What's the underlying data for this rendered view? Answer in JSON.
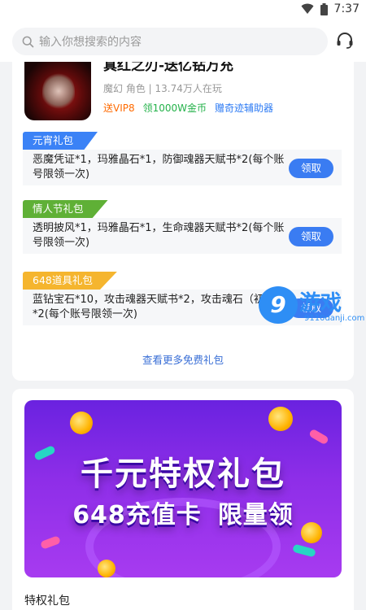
{
  "status_bar": {
    "time": "7:37",
    "icons": [
      "wifi-icon",
      "battery-icon"
    ]
  },
  "search": {
    "placeholder": "输入你想搜索的内容",
    "icon": "search-icon",
    "support_icon": "headset-icon"
  },
  "game": {
    "title": "真红之刃-送亿钻万充",
    "meta": "魔幻 角色 | 13.74万人在玩",
    "tags": [
      "送VIP8",
      "领1000W金币",
      "赠奇迹辅助器"
    ]
  },
  "gifts": [
    {
      "label": "元宵礼包",
      "label_color": "#3b82f6",
      "text": "恶魔凭证*1，玛雅晶石*1，防御魂器天赋书*2(每个账号限领一次)",
      "button": "领取"
    },
    {
      "label": "情人节礼包",
      "label_color": "#5fb036",
      "text": "透明披风*1，玛雅晶石*1，生命魂器天赋书*2(每个账号限领一次)",
      "button": "领取"
    },
    {
      "label": "648道具礼包",
      "label_color": "#f5b52e",
      "text": "蓝钻宝石*10，攻击魂器天赋书*2，攻击魂石（初级）*2(每个账号限领一次)",
      "button": "领取"
    }
  ],
  "more_link": "查看更多免费礼包",
  "watermark": {
    "badge": "9",
    "name": "游戏",
    "site": "9110danji.com"
  },
  "banner": {
    "title": "千元特权礼包",
    "sub_left": "648充值卡",
    "sub_right": "限量领"
  },
  "section_title": "特权礼包"
}
